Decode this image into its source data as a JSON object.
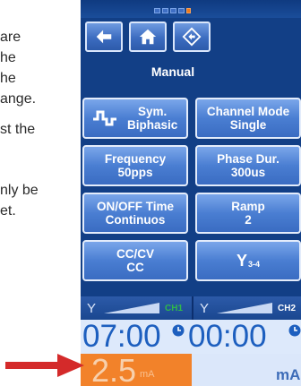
{
  "doc_text": {
    "lines": [
      "are",
      "he",
      "he",
      "ange.",
      "st the",
      "nly be",
      "et."
    ]
  },
  "device": {
    "title": "Manual",
    "nav": [
      "back-arrow-icon",
      "home-icon",
      "dpad-icon"
    ],
    "tiles": {
      "sym_biphasic": {
        "line1": "Sym.",
        "line2": "Biphasic",
        "icon": "biphasic-waveform-icon"
      },
      "channel_mode": {
        "line1": "Channel Mode",
        "line2": "Single"
      },
      "frequency": {
        "line1": "Frequency",
        "line2": "50pps"
      },
      "phase_dur": {
        "line1": "Phase Dur.",
        "line2": "300us"
      },
      "on_off_time": {
        "line1": "ON/OFF Time",
        "line2": "Continuos"
      },
      "ramp": {
        "line1": "Ramp",
        "line2": "2"
      },
      "cc_cv": {
        "line1": "CC/CV",
        "line2": "CC"
      },
      "electrode": {
        "glyph": "Y",
        "sub": "3-4",
        "icon": "electrode-icon"
      }
    },
    "channels": {
      "ch1": {
        "label": "CH1",
        "color": "#2fb84a"
      },
      "ch2": {
        "label": "CH2",
        "color": "#ffffff"
      }
    },
    "timers": {
      "left": "07:00",
      "right": "00:00"
    },
    "amplitude": {
      "ch1_value": "2.5",
      "ch1_unit": "mA",
      "ch2_unit": "mA"
    },
    "colors": {
      "orange": "#f2822a",
      "blue": "#123f86",
      "arrow": "#d42a2a"
    }
  }
}
